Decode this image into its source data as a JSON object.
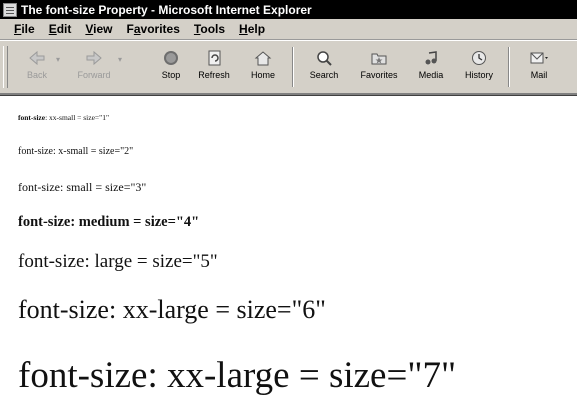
{
  "window": {
    "title": "The font-size Property - Microsoft Internet Explorer"
  },
  "menu": {
    "items": [
      {
        "label": "File",
        "u": "F",
        "rest": "ile"
      },
      {
        "label": "Edit",
        "u": "E",
        "rest": "dit"
      },
      {
        "label": "View",
        "u": "V",
        "rest": "iew"
      },
      {
        "label": "Favorites",
        "u": "a",
        "pre": "F",
        "rest": "vorites"
      },
      {
        "label": "Tools",
        "u": "T",
        "rest": "ools"
      },
      {
        "label": "Help",
        "u": "H",
        "rest": "elp"
      }
    ]
  },
  "toolbar": {
    "back": "Back",
    "forward": "Forward",
    "stop": "Stop",
    "refresh": "Refresh",
    "home": "Home",
    "search": "Search",
    "favorites": "Favorites",
    "media": "Media",
    "history": "History",
    "mail": "Mail"
  },
  "content": {
    "lines": [
      {
        "prop": "font-size",
        "text": ": xx-small = size=\"1\""
      },
      {
        "prop": "font-size",
        "text": ": x-small = size=\"2\""
      },
      {
        "prop": "font-size",
        "text": ": small = size=\"3\""
      },
      {
        "prop": "font-size",
        "text": ": medium = size=\"4\""
      },
      {
        "prop": "font-size",
        "text": ": large = size=\"5\""
      },
      {
        "prop": "font-size",
        "text": ": xx-large = size=\"6\""
      },
      {
        "prop": "font-size",
        "text": ": xx-large = size=\"7\""
      }
    ]
  }
}
